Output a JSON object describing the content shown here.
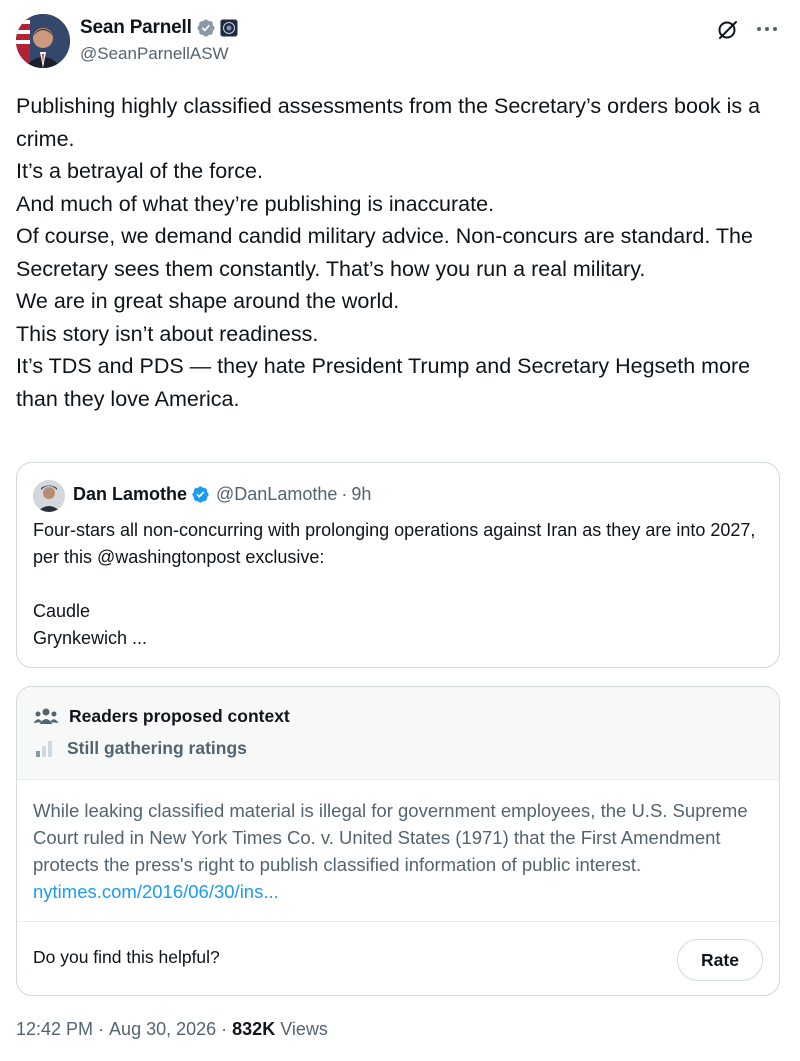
{
  "author": {
    "display_name": "Sean Parnell",
    "handle": "@SeanParnellASW"
  },
  "tweet": {
    "lines": [
      "Publishing highly classified assessments from the Secretary’s orders book is a crime.",
      "It’s a betrayal of the force.",
      "And much of what they’re publishing is inaccurate.",
      "Of course, we demand candid military advice. Non-concurs are standard. The Secretary sees them constantly. That’s how you run a real military.",
      "We are in great shape around the world.",
      "This story isn’t about readiness.",
      "It’s TDS and PDS — they hate President Trump and Secretary Hegseth more than they love America."
    ]
  },
  "quote": {
    "display_name": "Dan Lamothe",
    "handle": "@DanLamothe",
    "separator": "·",
    "time": "9h",
    "lines": [
      "Four-stars all non-concurring with prolonging operations against Iran as they are into 2027, per this @washingtonpost exclusive:",
      "",
      "Caudle",
      "Grynkewich ..."
    ]
  },
  "community_note": {
    "title": "Readers proposed context",
    "status": "Still gathering ratings",
    "body": "While leaking classified material is illegal for government employees, the U.S. Supreme Court ruled in New York Times Co. v. United States (1971) that the First Amendment protects the press's right to publish classified information of public interest.",
    "link_text": "nytimes.com/2016/06/30/ins...",
    "question": "Do you find this helpful?",
    "rate_label": "Rate"
  },
  "footer": {
    "time": "12:42 PM",
    "separator": "·",
    "date": "Aug 30, 2026",
    "views_count": "832K",
    "views_label": "Views"
  },
  "colors": {
    "text": "#0f1419",
    "secondary": "#536471",
    "link": "#1d9bf0",
    "verified": "#1d9bf0",
    "border": "#cfd9de",
    "note_header_bg": "#f7f9f9"
  },
  "icons": [
    "avatar",
    "verified-badge-icon",
    "org-badge-icon",
    "grok-icon",
    "more-icon",
    "people-icon",
    "bar-chart-icon"
  ]
}
